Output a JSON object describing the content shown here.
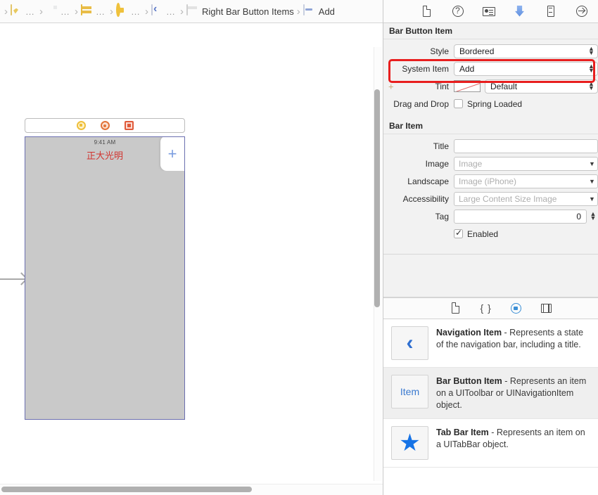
{
  "jumpbar": {
    "crumbs": [
      {
        "icon": "swift-file-icon",
        "label": "…"
      },
      {
        "icon": "document-icon",
        "label": "…"
      },
      {
        "icon": "storyboard-icon",
        "label": "…"
      },
      {
        "icon": "view-controller-icon",
        "label": "…"
      },
      {
        "icon": "navigation-bar-icon",
        "label": "…"
      },
      {
        "icon": "navigation-item-icon",
        "label": "Right Bar Button Items"
      },
      {
        "icon": "bar-button-item-icon",
        "label": "Add"
      }
    ]
  },
  "canvas": {
    "scene_dock": [
      "view-controller-icon",
      "first-responder-icon",
      "exit-icon"
    ],
    "device": {
      "status_time": "9:41 AM",
      "nav_title": "正大光明",
      "bar_button_glyph": "+"
    }
  },
  "inspector": {
    "tabs": [
      {
        "name": "file-inspector",
        "selected": false
      },
      {
        "name": "quick-help-inspector",
        "selected": false
      },
      {
        "name": "identity-inspector",
        "selected": false
      },
      {
        "name": "attributes-inspector",
        "selected": true
      },
      {
        "name": "size-inspector",
        "selected": false
      },
      {
        "name": "connections-inspector",
        "selected": false
      }
    ],
    "bar_button_item": {
      "header": "Bar Button Item",
      "style": {
        "label": "Style",
        "value": "Bordered"
      },
      "system_item": {
        "label": "System Item",
        "value": "Add",
        "highlighted": true
      },
      "tint": {
        "label": "Tint",
        "value": "Default",
        "swatch": "none"
      },
      "drag_and_drop": {
        "label": "Drag and Drop",
        "checkbox_label": "Spring Loaded",
        "checked": false
      }
    },
    "bar_item": {
      "header": "Bar Item",
      "title": {
        "label": "Title",
        "value": "",
        "placeholder": ""
      },
      "image": {
        "label": "Image",
        "value": "",
        "placeholder": "Image"
      },
      "landscape": {
        "label": "Landscape",
        "value": "",
        "placeholder": "Image (iPhone)"
      },
      "accessibility": {
        "label": "Accessibility",
        "value": "",
        "placeholder": "Large Content Size Image"
      },
      "tag": {
        "label": "Tag",
        "value": "0"
      },
      "enabled": {
        "label": "Enabled",
        "checked": true
      }
    }
  },
  "library": {
    "tabs": [
      {
        "name": "file-template-library",
        "selected": false
      },
      {
        "name": "code-snippet-library",
        "selected": false
      },
      {
        "name": "object-library",
        "selected": true
      },
      {
        "name": "media-library",
        "selected": false
      }
    ],
    "items": [
      {
        "thumb": "chevron-left-icon",
        "title": "Navigation Item",
        "desc": " - Represents a state of the navigation bar, including a title.",
        "selected": false
      },
      {
        "thumb": "item-text-icon",
        "title": "Bar Button Item",
        "desc": " - Represents an item on a UIToolbar or UINavigationItem object.",
        "selected": true
      },
      {
        "thumb": "star-icon",
        "title": "Tab Bar Item",
        "desc": " - Represents an item on a UITabBar object.",
        "selected": false
      }
    ]
  },
  "colors": {
    "highlight_red": "#e81e1e",
    "accent_blue": "#1673e6",
    "nav_title_red": "#d1342f"
  }
}
